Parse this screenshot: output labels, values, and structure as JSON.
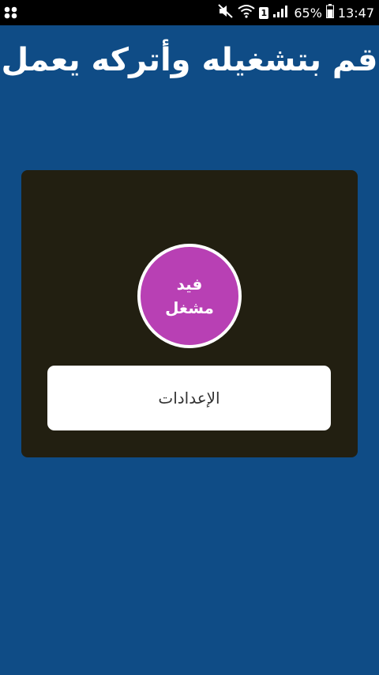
{
  "status_bar": {
    "sim_slot": "1",
    "battery_percent": "65%",
    "time": "13:47",
    "icons": [
      "notification-dots-icon",
      "mute-icon",
      "wifi-icon",
      "sim-icon",
      "signal-icon",
      "battery-icon"
    ]
  },
  "header": {
    "title": "قم بتشغيله وأتركه يعمل"
  },
  "main": {
    "toggle": {
      "line1": "فيد",
      "line2": "مشغل",
      "color": "#b840b4"
    },
    "settings_label": "الإعدادات"
  },
  "colors": {
    "background": "#0f4c86",
    "panel": "#221f11"
  }
}
